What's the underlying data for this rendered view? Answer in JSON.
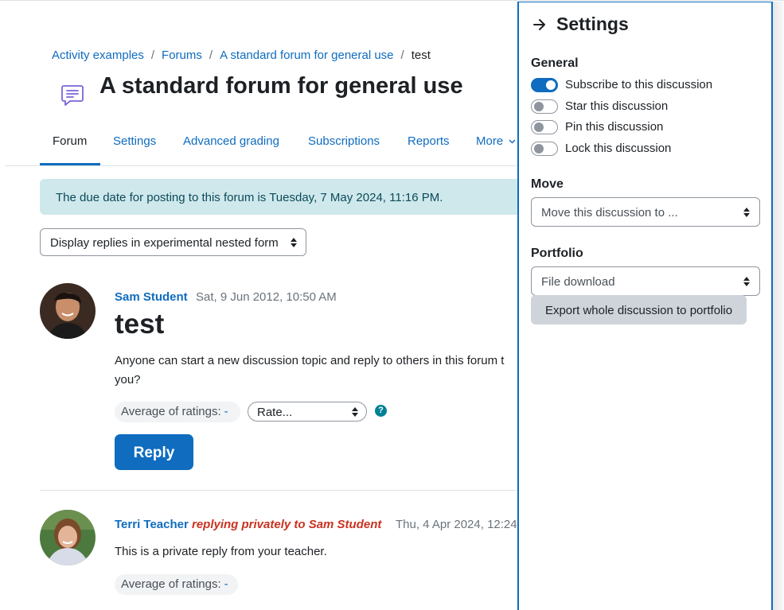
{
  "breadcrumb": {
    "items": [
      "Activity examples",
      "Forums",
      "A standard forum for general use"
    ],
    "separator": "/",
    "current": "test"
  },
  "page": {
    "title": "A standard forum for general use",
    "icon": "forum-icon"
  },
  "tabs": [
    {
      "label": "Forum"
    },
    {
      "label": "Settings"
    },
    {
      "label": "Advanced grading"
    },
    {
      "label": "Subscriptions"
    },
    {
      "label": "Reports"
    },
    {
      "label": "More"
    }
  ],
  "alert": {
    "text": "The due date for posting to this forum is Tuesday, 7 May 2024, 11:16 PM."
  },
  "display_mode": {
    "value": "Display replies in experimental nested form"
  },
  "posts": [
    {
      "author": "Sam Student",
      "date": "Sat, 9 Jun 2012, 10:50 AM",
      "subject": "test",
      "text": "Anyone can start a new discussion topic and reply to others in this forum t you?",
      "rating_label": "Average of ratings:",
      "rating_value": "-",
      "rate_placeholder": "Rate...",
      "reply_label": "Reply"
    },
    {
      "author": "Terri Teacher",
      "private_note": "replying privately to Sam Student",
      "date": "Thu, 4 Apr 2024, 12:24",
      "text": "This is a private reply from your teacher.",
      "rating_label": "Average of ratings:",
      "rating_value": "-"
    }
  ],
  "drawer": {
    "title": "Settings",
    "general": {
      "heading": "General",
      "toggles": [
        {
          "label": "Subscribe to this discussion",
          "on": true
        },
        {
          "label": "Star this discussion",
          "on": false
        },
        {
          "label": "Pin this discussion",
          "on": false
        },
        {
          "label": "Lock this discussion",
          "on": false
        }
      ]
    },
    "move": {
      "heading": "Move",
      "select_value": "Move this discussion to ..."
    },
    "portfolio": {
      "heading": "Portfolio",
      "select_value": "File download",
      "export_label": "Export whole discussion to portfolio"
    }
  },
  "colors": {
    "link": "#0f6cbf",
    "alert_bg": "#cfe8ec",
    "private": "#ca3120"
  }
}
